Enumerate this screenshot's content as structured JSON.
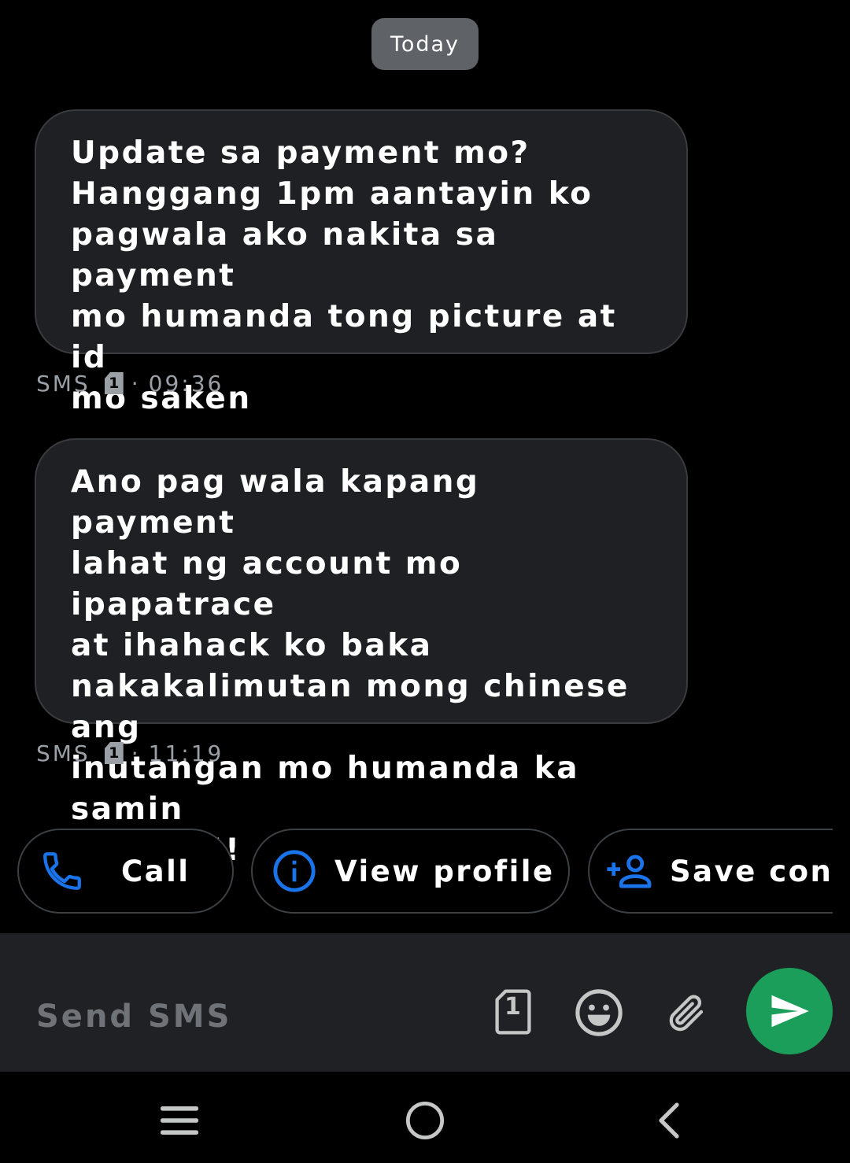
{
  "date_chip": "Today",
  "messages": [
    {
      "text": "Update sa payment mo?\nHanggang 1pm aantayin ko\npagwala ako nakita sa payment\nmo humanda tong picture at id\nmo saken",
      "type": "SMS",
      "sim": "1",
      "separator": "·",
      "time": "09:36"
    },
    {
      "text": "Ano pag wala kapang payment\nlahat ng account mo ipapatrace\nat ihahack ko baka\nnakakalimutan mong chinese ang\ninutangan mo humanda ka samin\nngayon!!",
      "type": "SMS",
      "sim": "1",
      "separator": "·",
      "time": "11:19"
    }
  ],
  "actions": {
    "call_label": "Call",
    "profile_label": "View profile",
    "save_label": "Save contact"
  },
  "compose": {
    "placeholder": "Send SMS",
    "sim": "1"
  },
  "icons": {
    "call": "phone-icon",
    "profile": "info-icon",
    "save": "add-person-icon",
    "sim": "sim-card-icon",
    "emoji": "emoji-icon",
    "attach": "paperclip-icon",
    "send": "send-icon",
    "recents": "recents-icon",
    "home": "home-icon",
    "back": "back-icon"
  },
  "colors": {
    "background": "#000000",
    "bubble": "#1f2023",
    "accent_blue": "#1a73e8",
    "send_green": "#1a9e5a",
    "meta_gray": "#9aa0a6"
  }
}
